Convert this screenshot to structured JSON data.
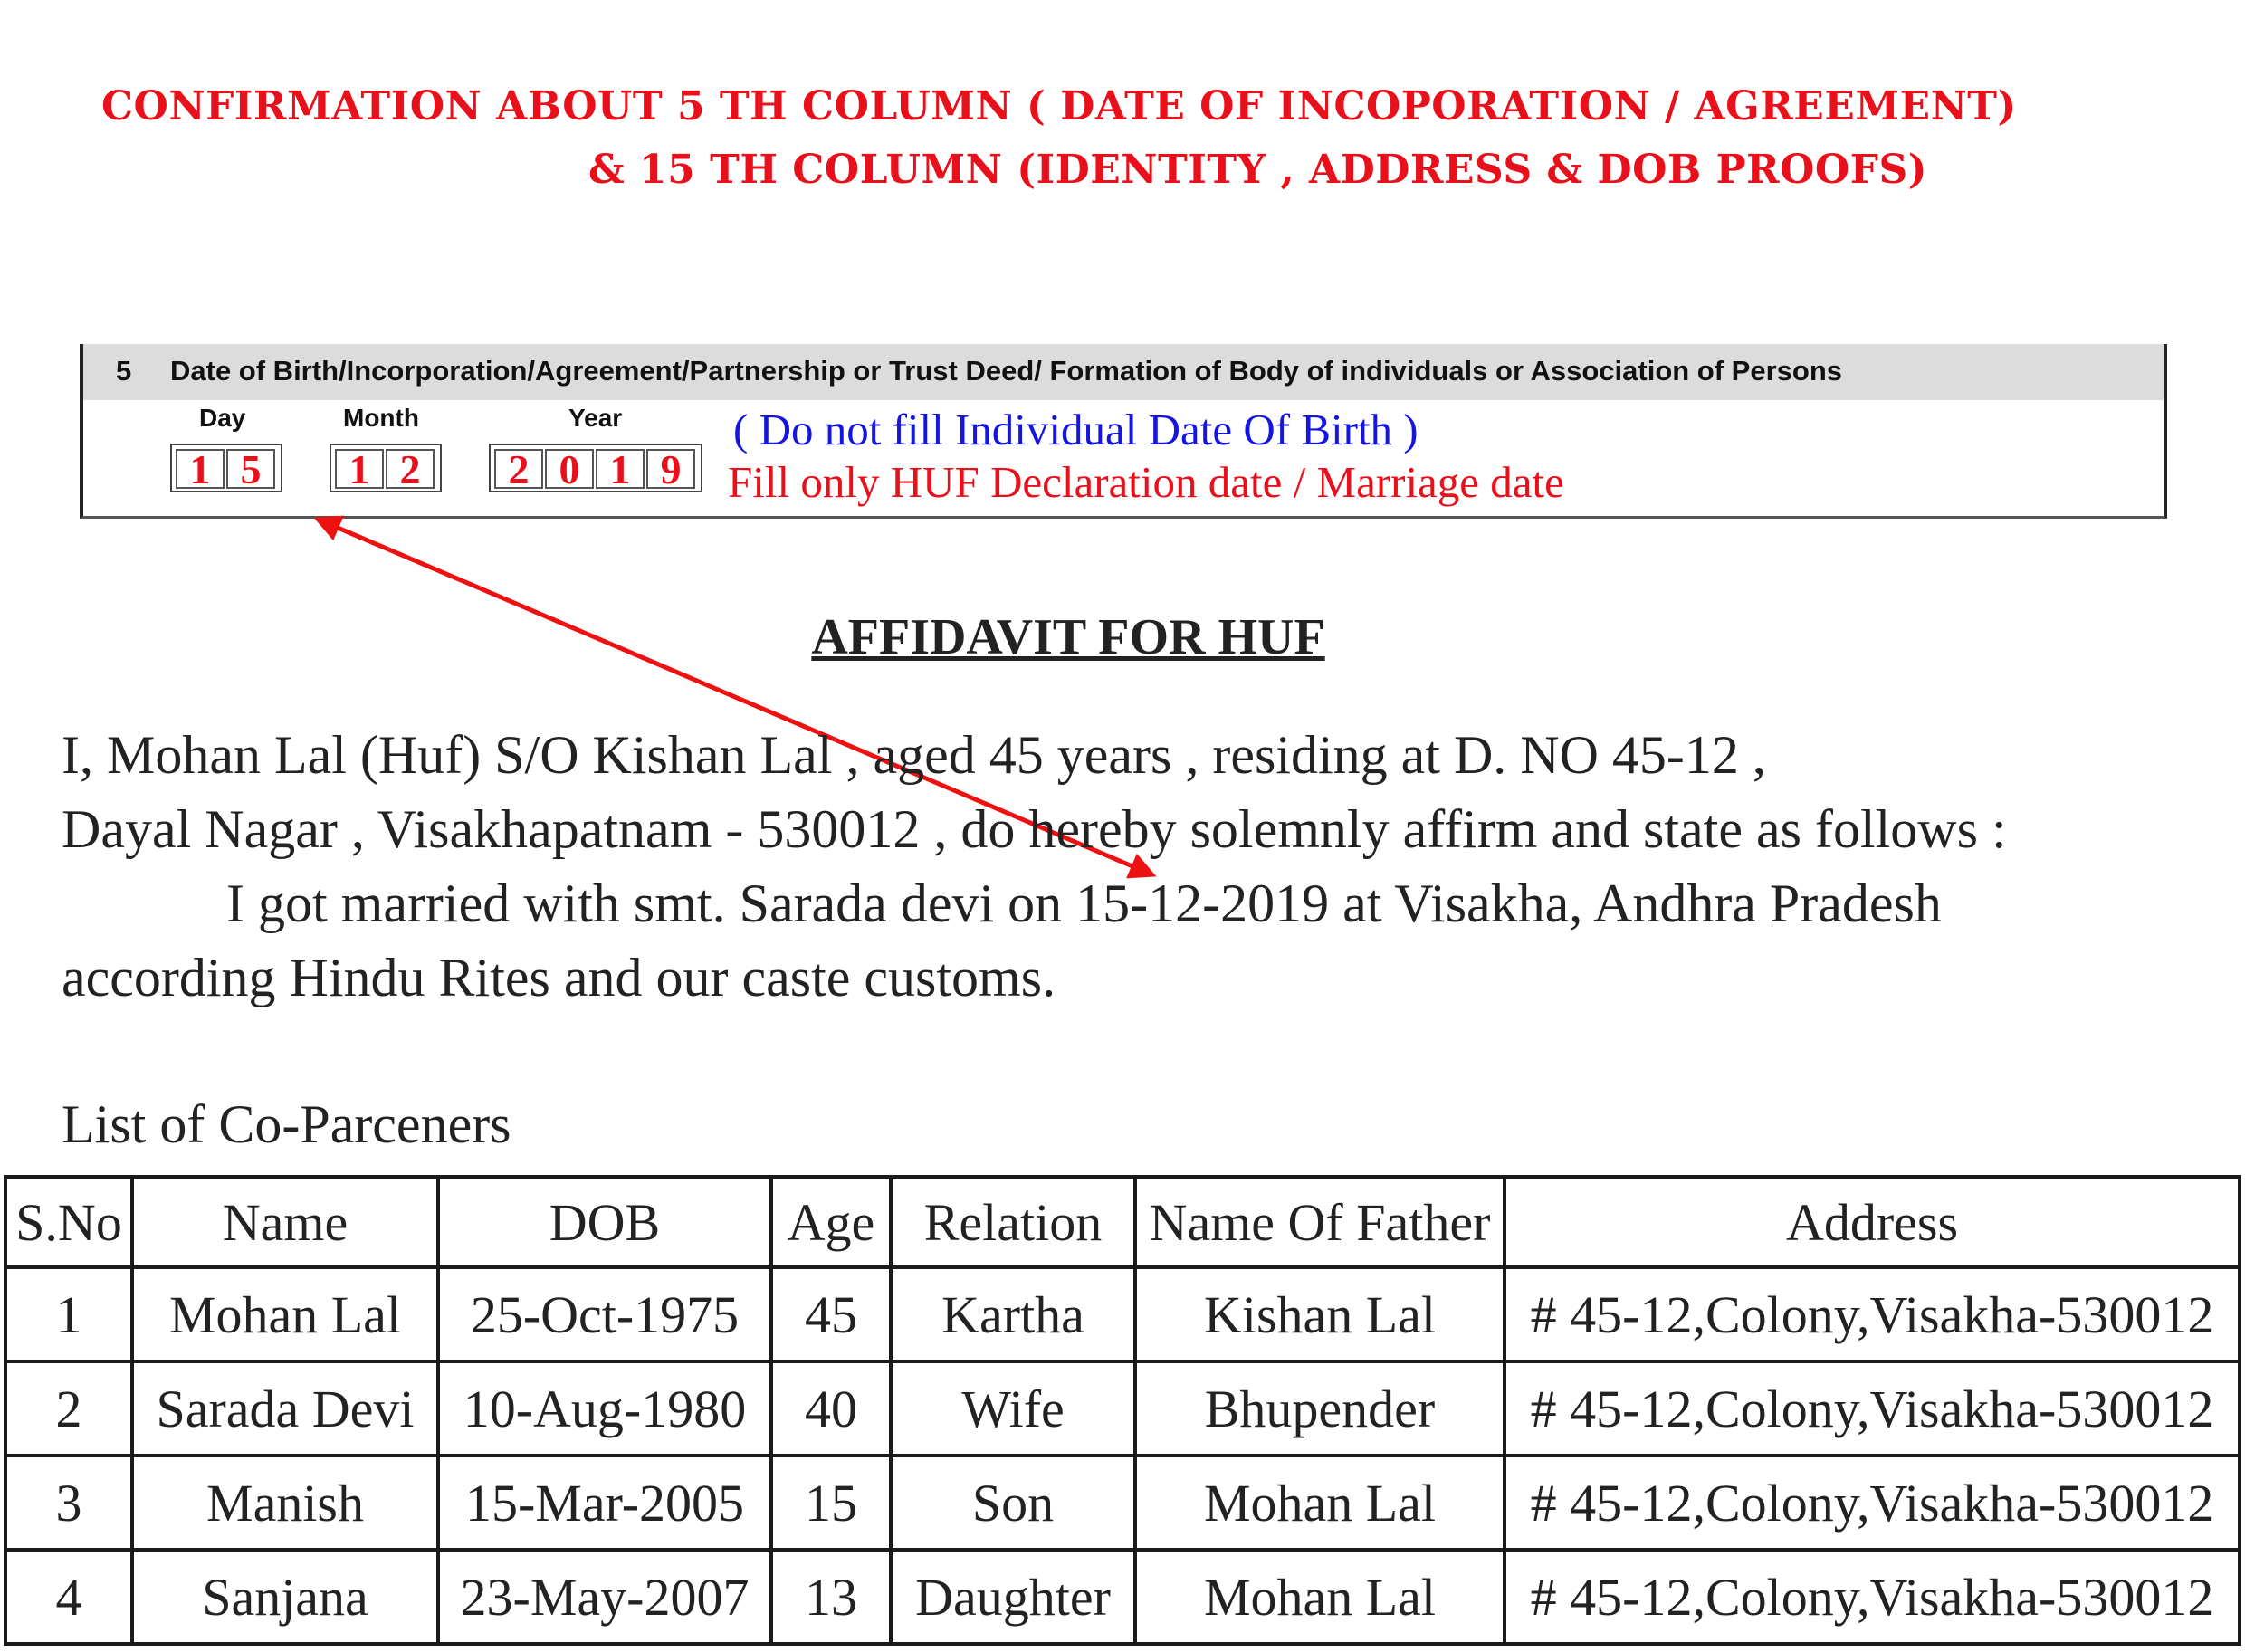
{
  "heading": {
    "line1": "CONFIRMATION ABOUT 5 TH COLUMN ( DATE OF INCOPORATION / AGREEMENT)",
    "line2": "& 15 TH COLUMN (IDENTITY  , ADDRESS & DOB PROOFS)"
  },
  "form5": {
    "number": "5",
    "title": "Date of Birth/Incorporation/Agreement/Partnership or Trust Deed/ Formation of Body of individuals or Association of Persons",
    "day_label": "Day",
    "month_label": "Month",
    "year_label": "Year",
    "day": [
      "1",
      "5"
    ],
    "month": [
      "1",
      "2"
    ],
    "year": [
      "2",
      "0",
      "1",
      "9"
    ],
    "note_blue": "( Do not fill Individual Date Of Birth )",
    "note_red": "Fill only HUF Declaration date / Marriage date"
  },
  "affidavit": {
    "title": "AFFIDAVIT FOR HUF",
    "line1": "I, Mohan Lal  (Huf) S/O  Kishan Lal , aged 45 years , residing at D. NO 45-12 ,",
    "line2": "Dayal Nagar , Visakhapatnam - 530012 , do hereby solemnly affirm and state as follows :",
    "line3": "I got married with smt. Sarada devi on 15-12-2019 at Visakha, Andhra Pradesh",
    "line4": "according Hindu Rites and our caste customs."
  },
  "coparceners": {
    "title": "List of Co-Parceners",
    "headers": [
      "S.No",
      "Name",
      "DOB",
      "Age",
      "Relation",
      "Name Of Father",
      "Address"
    ],
    "rows": [
      [
        "1",
        "Mohan Lal",
        "25-Oct-1975",
        "45",
        "Kartha",
        "Kishan Lal",
        "# 45-12,Colony,Visakha-530012"
      ],
      [
        "2",
        "Sarada Devi",
        "10-Aug-1980",
        "40",
        "Wife",
        "Bhupender",
        "# 45-12,Colony,Visakha-530012"
      ],
      [
        "3",
        "Manish",
        "15-Mar-2005",
        "15",
        "Son",
        "Mohan Lal",
        "# 45-12,Colony,Visakha-530012"
      ],
      [
        "4",
        "Sanjana",
        "23-May-2007",
        "13",
        "Daughter",
        "Mohan Lal",
        "# 45-12,Colony,Visakha-530012"
      ]
    ]
  },
  "colors": {
    "heading_red": "#e8101a",
    "note_blue": "#1515e0",
    "arrow_red": "#ee1111"
  }
}
